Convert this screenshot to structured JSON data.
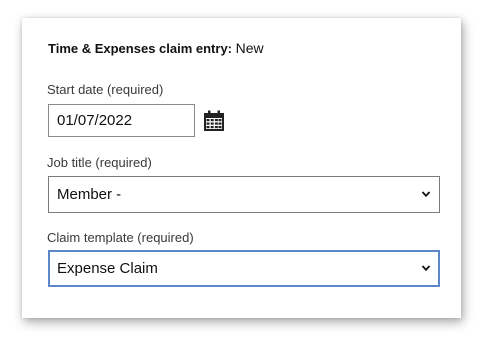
{
  "form": {
    "heading_bold": "Time & Expenses claim entry:",
    "status": "New",
    "start_date": {
      "label": "Start date (required)",
      "value": "01/07/2022"
    },
    "job_title": {
      "label": "Job title (required)",
      "selected": "Member -"
    },
    "claim_template": {
      "label": "Claim template (required)",
      "selected": "Expense Claim"
    }
  },
  "colors": {
    "focus_border": "#5b86c8",
    "field_border": "#7a7a7a"
  },
  "icons": {
    "calendar": "calendar-icon",
    "dropdown": "chevron-down-icon"
  }
}
